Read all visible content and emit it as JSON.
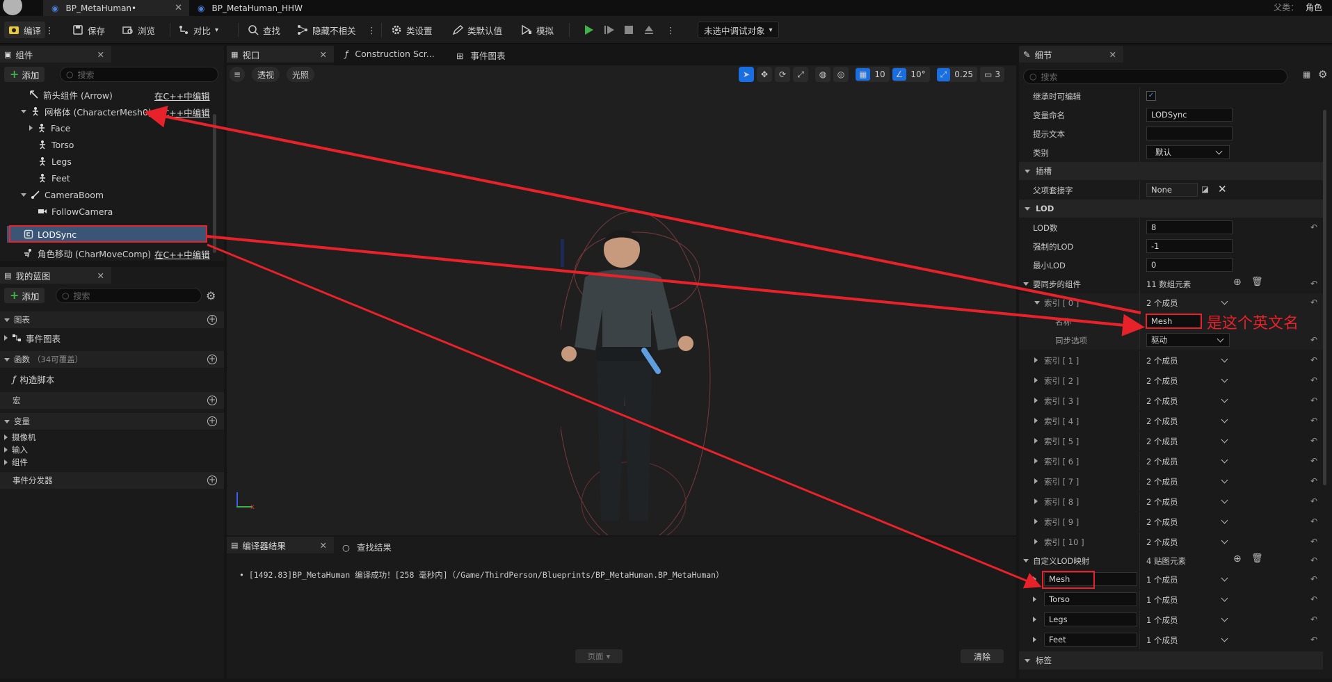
{
  "title_tabs": [
    {
      "label": "BP_MetaHuman•",
      "active": true
    },
    {
      "label": "BP_MetaHuman_HHW",
      "active": false
    }
  ],
  "parent_class": {
    "label": "父类：",
    "value": "角色"
  },
  "toolbar": {
    "compile": "编译",
    "save": "保存",
    "browse": "浏览",
    "diff": "对比",
    "find": "查找",
    "hide_unrelated": "隐藏不相关",
    "class_settings": "类设置",
    "class_defaults": "类默认值",
    "simulate": "模拟",
    "debug_target": "未选中调试对象"
  },
  "components_panel": {
    "tab": "组件",
    "add": "添加",
    "search_placeholder": "搜索",
    "items": [
      {
        "label": "箭头组件 (Arrow)",
        "edit": "在C++中编辑"
      },
      {
        "label": "网格体 (CharacterMesh0)",
        "edit": "在C++中编辑"
      },
      {
        "label": "Face"
      },
      {
        "label": "Torso"
      },
      {
        "label": "Legs"
      },
      {
        "label": "Feet"
      },
      {
        "label": "CameraBoom"
      },
      {
        "label": "FollowCamera"
      },
      {
        "label": "LODSync"
      },
      {
        "label": "角色移动 (CharMoveComp)",
        "edit": "在C++中编辑"
      }
    ]
  },
  "my_blueprint": {
    "tab": "我的蓝图",
    "add": "添加",
    "search_placeholder": "搜索",
    "sections": {
      "graphs": "图表",
      "event_graph": "事件图表",
      "functions": "函数",
      "functions_note": "（34可覆盖）",
      "construction_script": "构造脚本",
      "macros": "宏",
      "variables": "变量",
      "camera": "摄像机",
      "input": "输入",
      "components": "组件",
      "event_dispatchers": "事件分发器"
    }
  },
  "editor_tabs": {
    "viewport": "视口",
    "construction": "Construction Scr...",
    "event_graph": "事件图表"
  },
  "viewport": {
    "perspective": "透视",
    "lit": "光照",
    "grid_snap": "10",
    "rot_snap": "10°",
    "scale_snap": "0.25",
    "camera_speed": "3"
  },
  "compiler": {
    "tab_results": "编译器结果",
    "tab_find": "查找结果",
    "message": "[1492.83]BP_MetaHuman 编译成功！[258 毫秒内]（/Game/ThirdPerson/Blueprints/BP_MetaHuman.BP_MetaHuman）",
    "page": "页面",
    "clear": "清除"
  },
  "details": {
    "tab": "细节",
    "search_placeholder": "搜索",
    "rows": {
      "editable_inherit": "继承时可编辑",
      "var_name_label": "变量命名",
      "var_name_value": "LODSync",
      "tooltip_label": "提示文本",
      "category_label": "类别",
      "category_value": "默认",
      "sockets_section": "插槽",
      "parent_socket_label": "父项套接字",
      "parent_socket_value": "None",
      "lod_section": "LOD",
      "lod_count_label": "LOD数",
      "lod_count_value": "8",
      "forced_lod_label": "强制的LOD",
      "forced_lod_value": "-1",
      "min_lod_label": "最小LOD",
      "min_lod_value": "0",
      "sync_components_label": "要同步的组件",
      "sync_components_value": "11 数组元素",
      "index0_label": "索引 [ 0 ]",
      "index0_value": "2 个成员",
      "name_label": "名称",
      "name_value": "Mesh",
      "sync_option_label": "同步选项",
      "sync_option_value": "驱动",
      "indices": [
        {
          "label": "索引 [ 1 ]",
          "value": "2 个成员"
        },
        {
          "label": "索引 [ 2 ]",
          "value": "2 个成员"
        },
        {
          "label": "索引 [ 3 ]",
          "value": "2 个成员"
        },
        {
          "label": "索引 [ 4 ]",
          "value": "2 个成员"
        },
        {
          "label": "索引 [ 5 ]",
          "value": "2 个成员"
        },
        {
          "label": "索引 [ 6 ]",
          "value": "2 个成员"
        },
        {
          "label": "索引 [ 7 ]",
          "value": "2 个成员"
        },
        {
          "label": "索引 [ 8 ]",
          "value": "2 个成员"
        },
        {
          "label": "索引 [ 9 ]",
          "value": "2 个成员"
        },
        {
          "label": "索引 [ 10 ]",
          "value": "2 个成员"
        }
      ],
      "custom_lod_label": "自定义LOD映射",
      "custom_lod_value": "4 贴图元素",
      "map": [
        {
          "key": "Mesh",
          "value": "1 个成员"
        },
        {
          "key": "Torso",
          "value": "1 个成员"
        },
        {
          "key": "Legs",
          "value": "1 个成员"
        },
        {
          "key": "Feet",
          "value": "1 个成员"
        }
      ],
      "tags_section": "标签"
    }
  },
  "annotation": {
    "text": "是这个英文名",
    "color": "#e8222a"
  },
  "colors": {
    "accent_blue": "#1a6fe0",
    "selection": "#3a5575",
    "annotation_red": "#e8222a"
  }
}
